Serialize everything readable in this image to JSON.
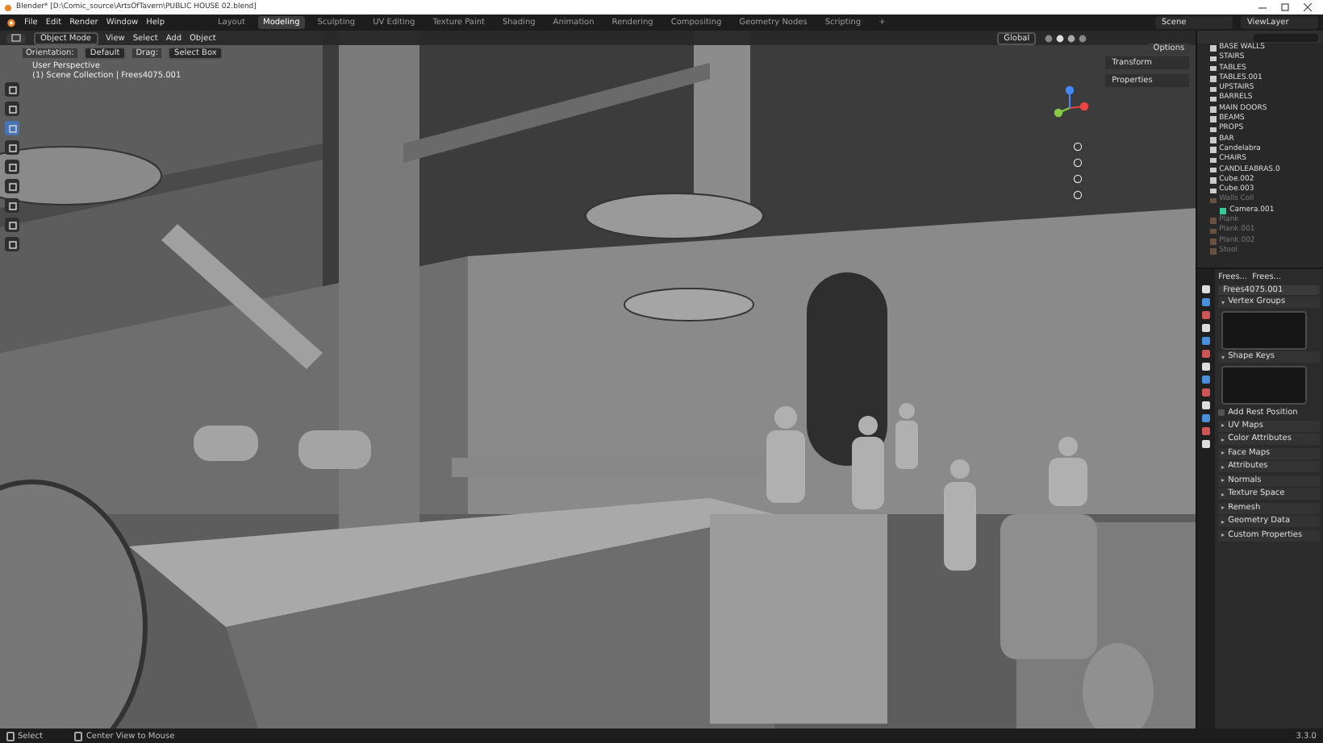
{
  "window": {
    "title": "Blender* [D:\\Comic_source\\ArtsOfTavern\\PUBLIC HOUSE 02.blend]"
  },
  "menus": [
    "File",
    "Edit",
    "Render",
    "Window",
    "Help"
  ],
  "workspaces": [
    {
      "label": "Layout",
      "selected": false
    },
    {
      "label": "Modeling",
      "selected": true
    },
    {
      "label": "Sculpting",
      "selected": false
    },
    {
      "label": "UV Editing",
      "selected": false
    },
    {
      "label": "Texture Paint",
      "selected": false
    },
    {
      "label": "Shading",
      "selected": false
    },
    {
      "label": "Animation",
      "selected": false
    },
    {
      "label": "Rendering",
      "selected": false
    },
    {
      "label": "Compositing",
      "selected": false
    },
    {
      "label": "Geometry Nodes",
      "selected": false
    },
    {
      "label": "Scripting",
      "selected": false
    }
  ],
  "add_workspace": "+",
  "scene": {
    "scene": "Scene",
    "view_layer": "ViewLayer"
  },
  "viewport": {
    "mode": "Object Mode",
    "menus": [
      "View",
      "Select",
      "Add",
      "Object"
    ],
    "orientation": "Global",
    "tool_settings": {
      "orientation_label": "Orientation:",
      "orientation": "Default",
      "drag_label": "Drag:",
      "drag": "Select Box"
    },
    "overlay_lines": [
      "User Perspective",
      "(1) Scene Collection | Frees4075.001"
    ],
    "options": "Options",
    "sidebar_tabs": [
      "Transform",
      "Properties"
    ],
    "tools": [
      {
        "selected": false
      },
      {
        "selected": false
      },
      {
        "selected": true
      },
      {
        "selected": false
      },
      {
        "selected": false
      },
      {
        "selected": false
      },
      {
        "selected": false
      },
      {
        "selected": false
      },
      {
        "selected": false
      }
    ]
  },
  "outliner": {
    "items": [
      {
        "label": "BASE WALLS",
        "disabled": false
      },
      {
        "label": "STAIRS",
        "disabled": false
      },
      {
        "label": "TABLES",
        "disabled": false
      },
      {
        "label": "TABLES.001",
        "disabled": false
      },
      {
        "label": "UPSTAIRS",
        "disabled": false
      },
      {
        "label": "BARRELS",
        "disabled": false
      },
      {
        "label": "MAIN DOORS",
        "disabled": false
      },
      {
        "label": "BEAMS",
        "disabled": false
      },
      {
        "label": "PROPS",
        "disabled": false
      },
      {
        "label": "BAR",
        "disabled": false
      },
      {
        "label": "Candelabra",
        "disabled": false
      },
      {
        "label": "CHAIRS",
        "disabled": false
      },
      {
        "label": "CANDLEABRAS.0",
        "disabled": false
      },
      {
        "label": "Cube.002",
        "disabled": false
      },
      {
        "label": "Cube.003",
        "disabled": false
      },
      {
        "label": "Walls Coll",
        "disabled": true,
        "children": [
          {
            "label": "Camera.001",
            "disabled": false
          }
        ]
      },
      {
        "label": "Plank",
        "disabled": true
      },
      {
        "label": "Plank.001",
        "disabled": true
      },
      {
        "label": "Plank.002",
        "disabled": true
      },
      {
        "label": "Stool",
        "disabled": true
      }
    ]
  },
  "properties": {
    "breadcrumb": [
      "Frees...",
      "Frees..."
    ],
    "mesh_name": "Frees4075.001",
    "sections": [
      {
        "kind": "panel",
        "label": "Vertex Groups",
        "expanded": true
      },
      {
        "kind": "panel",
        "label": "Shape Keys",
        "expanded": true
      },
      {
        "kind": "checkbox",
        "label": "Add Rest Position",
        "checked": false
      },
      {
        "kind": "panel",
        "label": "UV Maps",
        "expanded": false
      },
      {
        "kind": "panel",
        "label": "Color Attributes",
        "expanded": false
      },
      {
        "kind": "panel",
        "label": "Face Maps",
        "expanded": false
      },
      {
        "kind": "panel",
        "label": "Attributes",
        "expanded": false
      },
      {
        "kind": "panel",
        "label": "Normals",
        "expanded": false
      },
      {
        "kind": "panel",
        "label": "Texture Space",
        "expanded": false
      },
      {
        "kind": "panel",
        "label": "Remesh",
        "expanded": false
      },
      {
        "kind": "panel",
        "label": "Geometry Data",
        "expanded": false
      },
      {
        "kind": "panel",
        "label": "Custom Properties",
        "expanded": false
      }
    ]
  },
  "status_bar": {
    "items": [
      "Select",
      "Center View to Mouse"
    ],
    "version": "3.3.0"
  }
}
